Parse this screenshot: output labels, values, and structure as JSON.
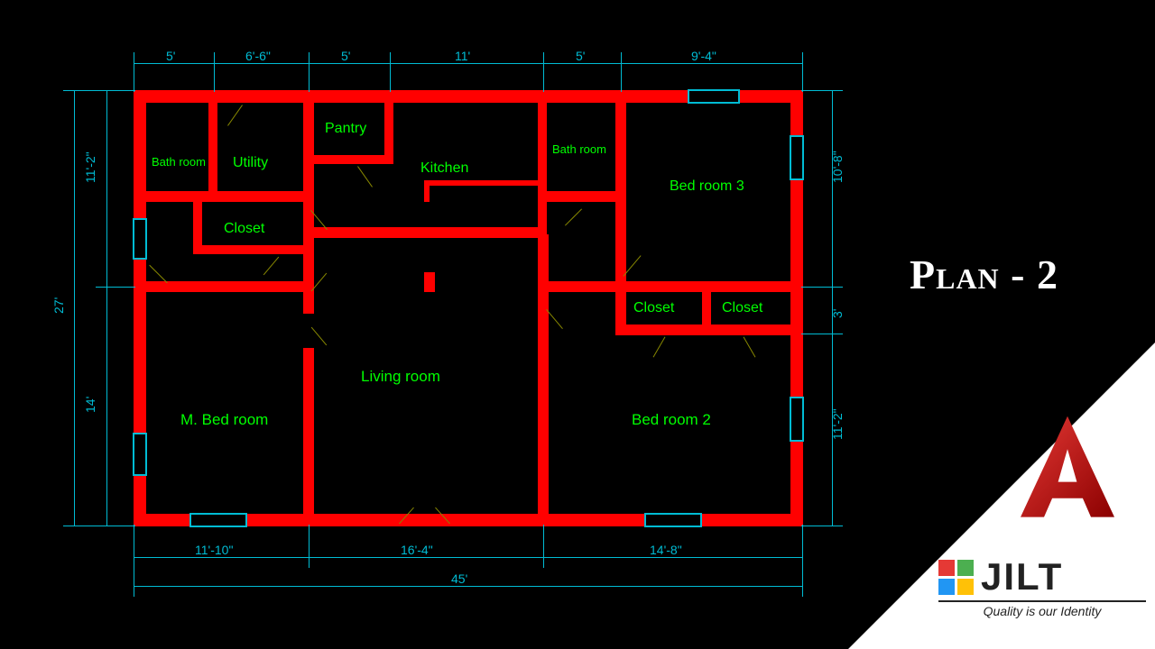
{
  "title": "Plan - 2",
  "rooms": {
    "bath1": "Bath room",
    "utility": "Utility",
    "pantry": "Pantry",
    "kitchen": "Kitchen",
    "bath2": "Bath room",
    "bed3": "Bed room 3",
    "closet1": "Closet",
    "closet2": "Closet",
    "closet3": "Closet",
    "living": "Living room",
    "mbed": "M. Bed room",
    "bed2": "Bed room 2"
  },
  "dims": {
    "top1": "5'",
    "top2": "6'-6\"",
    "top3": "5'",
    "top4": "11'",
    "top5": "5'",
    "top6": "9'-4\"",
    "left1": "11'-2\"",
    "left2": "27'",
    "left3": "14'",
    "right1": "10'-8\"",
    "right2": "3'",
    "right3": "11'-2\"",
    "bot1": "11'-10\"",
    "bot2": "16'-4\"",
    "bot3": "14'-8\"",
    "bot4": "45'"
  },
  "brand": {
    "name": "JILT",
    "tag": "Quality is our Identity"
  },
  "autocad_letter": "A"
}
